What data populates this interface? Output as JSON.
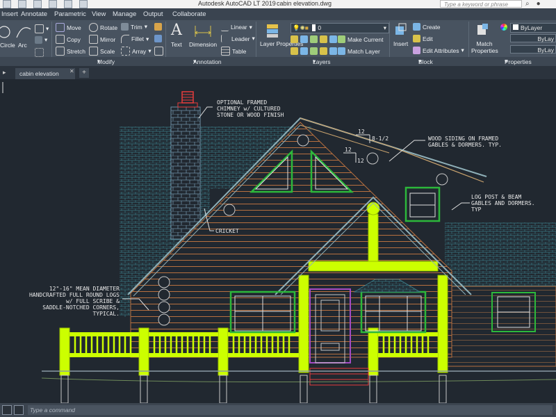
{
  "window": {
    "app_title": "Autodesk AutoCAD LT 2019",
    "file_name": "cabin elevation.dwg",
    "search_placeholder": "Type a keyword or phrase"
  },
  "menu_tabs": [
    "Insert",
    "Annotate",
    "Parametric",
    "View",
    "Manage",
    "Output",
    "Collaborate"
  ],
  "ribbon": {
    "draw_items": [
      "Circle",
      "Arc"
    ],
    "modify": {
      "items": [
        "Move",
        "Rotate",
        "Trim",
        "Copy",
        "Mirror",
        "Fillet",
        "Stretch",
        "Scale",
        "Array"
      ],
      "label": "Modify"
    },
    "annotation": {
      "text": "Text",
      "dimension": "Dimension",
      "linear": "Linear",
      "leader": "Leader",
      "table": "Table",
      "label": "Annotation"
    },
    "layers": {
      "properties": "Layer Properties",
      "current_layer": "0",
      "make_current": "Make Current",
      "match_layer": "Match Layer",
      "label": "Layers"
    },
    "block": {
      "insert": "Insert",
      "create": "Create",
      "edit": "Edit",
      "edit_attributes": "Edit Attributes",
      "label": "Block"
    },
    "properties": {
      "match_properties": "Match Properties",
      "color": "ByLayer",
      "linetype": "ByLay",
      "lineweight": "ByLay",
      "label": "Properties"
    }
  },
  "doc_tab": "cabin elevation",
  "drawing": {
    "notes": {
      "chimney": [
        "OPTIONAL FRAMED",
        "CHIMNEY w/ CULTURED",
        "STONE OR WOOD FINISH"
      ],
      "siding": [
        "WOOD SIDING ON FRAMED",
        "GABLES & DORMERS. TYP."
      ],
      "post_beam": [
        "LOG POST & BEAM",
        "GABLES AND DORMERS.",
        "TYP"
      ],
      "cricket": "CRICKET",
      "logs": [
        "12\"-16\" MEAN DIAMETER",
        "HANDCRAFTED FULL ROUND LOGS",
        "w/ FULL SCRIBE &",
        "SADDLE-NOTCHED CORNERS,",
        "TYPICAL."
      ]
    },
    "pitch_labels": [
      "12",
      "8-1/2",
      "12",
      "12"
    ]
  },
  "command_placeholder": "Type a command",
  "colors": {
    "background": "#212830",
    "log_accent": "#ccff00",
    "roof": "#8fb0b8",
    "log_walls": "#b8703f",
    "window": "#2cb83b",
    "door": "#a34bc4",
    "brick": "#3a7a86"
  }
}
